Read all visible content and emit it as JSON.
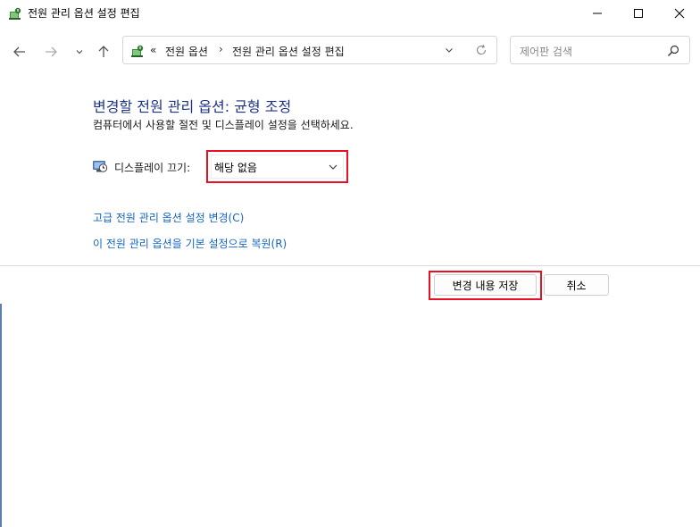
{
  "window": {
    "title": "전원 관리 옵션 설정 편집",
    "icons": {
      "app": "power-options-icon",
      "minimize": "minimize-icon",
      "maximize": "maximize-icon",
      "close": "close-icon"
    }
  },
  "nav": {
    "icons": {
      "back": "back-arrow-icon",
      "forward": "forward-arrow-icon",
      "recent": "chevron-down-icon",
      "up": "up-arrow-icon"
    }
  },
  "address": {
    "overflow": "«",
    "crumbs": [
      "전원 옵션",
      "전원 관리 옵션 설정 편집"
    ],
    "separator": "›"
  },
  "search": {
    "placeholder": "제어판 검색"
  },
  "main": {
    "heading": "변경할 전원 관리 옵션: 균형 조정",
    "subtext": "컴퓨터에서 사용할 절전 및 디스플레이 설정을 선택하세요.",
    "display_label": "디스플레이 끄기:",
    "display_value": "해당 없음",
    "link_advanced": "고급 전원 관리 옵션 설정 변경(C)",
    "link_restore": "이 전원 관리 옵션을 기본 설정으로 복원(R)"
  },
  "buttons": {
    "save": "변경 내용 저장",
    "cancel": "취소"
  },
  "colors": {
    "heading": "#1e3287",
    "link": "#1565c0",
    "highlight": "#e81123"
  }
}
